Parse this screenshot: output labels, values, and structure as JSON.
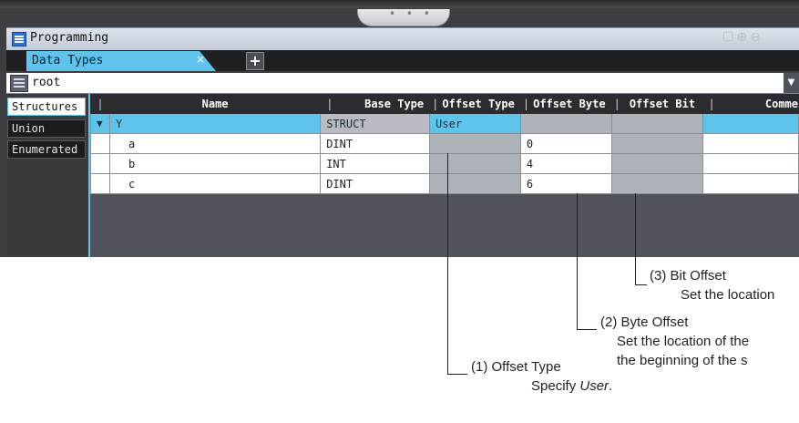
{
  "window": {
    "title": "Programming",
    "grab_handle": "• • •",
    "tools": "☐⊕⊖"
  },
  "tabs": [
    {
      "label": "Data Types",
      "close": "×"
    }
  ],
  "add_tab_label": "+",
  "path": {
    "text": "root",
    "dropdown": "▼"
  },
  "side_tabs": [
    {
      "label": "Structures",
      "active": true
    },
    {
      "label": "Union",
      "active": false
    },
    {
      "label": "Enumerated",
      "active": false
    }
  ],
  "columns": {
    "sep": "|",
    "name": "Name",
    "base_type": "Base Type",
    "offset_type": "Offset Type",
    "offset_byte": "Offset Byte",
    "offset_bit": "Offset Bit",
    "comment": "Comme"
  },
  "rows": [
    {
      "expand": "▼",
      "name": "Y",
      "base_type": "STRUCT",
      "offset_type": "User",
      "offset_byte": "",
      "offset_bit": "",
      "comment": ""
    },
    {
      "expand": "",
      "name": "a",
      "base_type": "DINT",
      "offset_type": "",
      "offset_byte": "0",
      "offset_bit": "",
      "comment": ""
    },
    {
      "expand": "",
      "name": "b",
      "base_type": "INT",
      "offset_type": "",
      "offset_byte": "4",
      "offset_bit": "",
      "comment": ""
    },
    {
      "expand": "",
      "name": "c",
      "base_type": "DINT",
      "offset_type": "",
      "offset_byte": "6",
      "offset_bit": "",
      "comment": ""
    }
  ],
  "annotations": {
    "bit_offset": {
      "title": "(3) Bit Offset",
      "desc": "Set the location"
    },
    "byte_offset": {
      "title": "(2) Byte Offset",
      "desc1": "Set the location of the",
      "desc2": "the beginning of the s"
    },
    "offset_type": {
      "title": "(1) Offset Type",
      "desc_prefix": "Specify ",
      "desc_em": "User",
      "desc_suffix": "."
    }
  },
  "colors": {
    "accent": "#5ec4ec",
    "frame": "#3e3e40",
    "locked_cell": "#aeb2b9"
  }
}
